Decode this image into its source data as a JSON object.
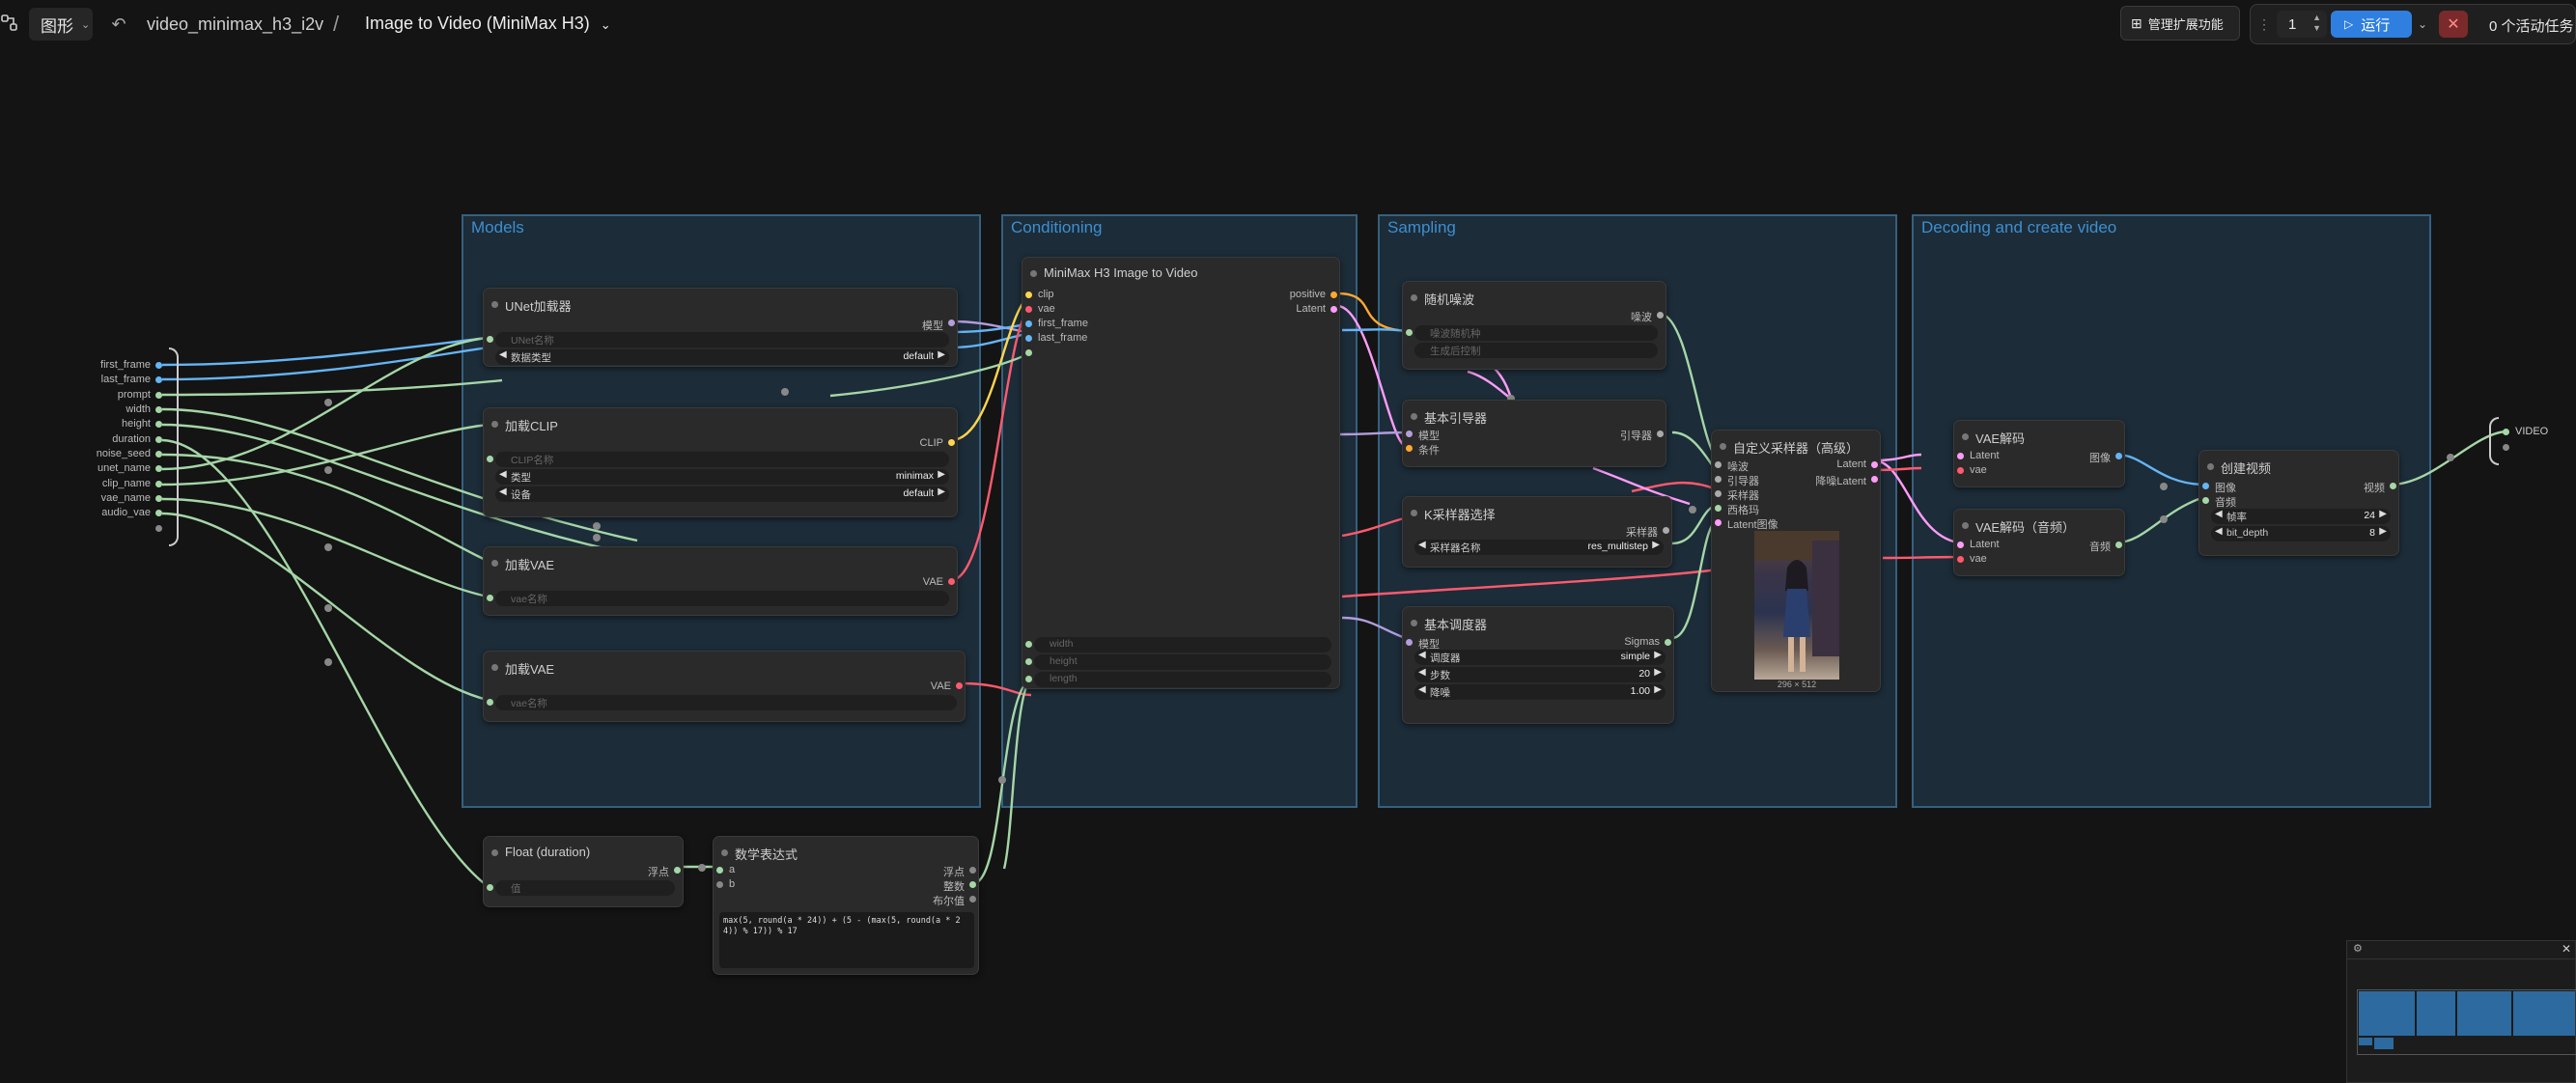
{
  "topbar": {
    "graph_menu_label": "图形",
    "workflow_name": "video_minimax_h3_i2v",
    "separator": "/",
    "subgraph_title": "Image to Video (MiniMax H3)",
    "manage_extensions_label": "管理扩展功能",
    "batch_count": "1",
    "run_label": "运行",
    "active_tasks_label": "0 个活动任务"
  },
  "inputs_bar": {
    "labels": [
      "first_frame",
      "last_frame",
      "prompt",
      "width",
      "height",
      "duration",
      "noise_seed",
      "unet_name",
      "clip_name",
      "vae_name",
      "audio_vae"
    ]
  },
  "output_bar": {
    "label": "VIDEO"
  },
  "groups": {
    "models": "Models",
    "conditioning": "Conditioning",
    "sampling": "Sampling",
    "decoding": "Decoding and create video"
  },
  "nodes": {
    "unet": {
      "title": "UNet加载器",
      "out_model": "模型",
      "w_name_placeholder": "UNet名称",
      "w_dtype_label": "数据类型",
      "w_dtype_value": "default"
    },
    "clip": {
      "title": "加载CLIP",
      "out_clip": "CLIP",
      "w_name_placeholder": "CLIP名称",
      "w_type_label": "类型",
      "w_type_value": "minimax",
      "w_device_label": "设备",
      "w_device_value": "default"
    },
    "vae1": {
      "title": "加载VAE",
      "out_vae": "VAE",
      "w_name_placeholder": "vae名称"
    },
    "vae2": {
      "title": "加载VAE",
      "out_vae": "VAE",
      "w_name_placeholder": "vae名称"
    },
    "cond": {
      "title": "MiniMax H3 Image to Video",
      "in_clip": "clip",
      "in_vae": "vae",
      "in_first": "first_frame",
      "in_last": "last_frame",
      "out_pos": "positive",
      "out_latent": "Latent",
      "w_width": "width",
      "w_height": "height",
      "w_length": "length"
    },
    "noise": {
      "title": "随机噪波",
      "out_noise": "噪波",
      "w_seed": "噪波随机种",
      "w_ctrl": "生成后控制"
    },
    "guider": {
      "title": "基本引导器",
      "in_model": "模型",
      "in_cond": "条件",
      "out_guider": "引导器"
    },
    "ksel": {
      "title": "K采样器选择",
      "out_sampler": "采样器",
      "w_label": "采样器名称",
      "w_value": "res_multistep"
    },
    "sched": {
      "title": "基本调度器",
      "in_model": "模型",
      "out_sigmas": "Sigmas",
      "w1_label": "调度器",
      "w1_value": "simple",
      "w2_label": "步数",
      "w2_value": "20",
      "w3_label": "降噪",
      "w3_value": "1.00"
    },
    "adv": {
      "title": "自定义采样器（高级）",
      "in_noise": "噪波",
      "in_guider": "引导器",
      "in_sampler": "采样器",
      "in_sigmas": "西格玛",
      "in_latent": "Latent图像",
      "out_latent": "Latent",
      "out_denoised": "降噪Latent",
      "preview_size": "296 × 512"
    },
    "vaedec": {
      "title": "VAE解码",
      "in_latent": "Latent",
      "in_vae": "vae",
      "out_image": "图像"
    },
    "vaedec_audio": {
      "title": "VAE解码（音频）",
      "in_latent": "Latent",
      "in_vae": "vae",
      "out_audio": "音频"
    },
    "createvid": {
      "title": "创建视频",
      "in_image": "图像",
      "in_audio": "音频",
      "out_video": "视频",
      "w1_label": "帧率",
      "w1_value": "24",
      "w2_label": "bit_depth",
      "w2_value": "8"
    },
    "float": {
      "title": "Float (duration)",
      "out_float": "浮点",
      "w_placeholder": "值"
    },
    "math": {
      "title": "数学表达式",
      "in_a": "a",
      "in_b": "b",
      "out_float": "浮点",
      "out_int": "整数",
      "out_bool": "布尔值",
      "expression": "max(5, round(a * 24)) + (5 - (max(5, round(a * 24)) % 17)) % 17"
    }
  },
  "colors": {
    "background": "#141414",
    "group_fill": "#26485f",
    "group_border": "#35607f",
    "run_button": "#2f7fe0",
    "stop_button": "#7a2a2a",
    "wire_model": "#b39ddb",
    "wire_clip": "#ffd54f",
    "wire_vae": "#ff5a6e",
    "wire_image": "#64b5f6",
    "wire_latent": "#ff9cf9",
    "wire_int": "#a5d6a7",
    "wire_cond": "#ffa931"
  }
}
